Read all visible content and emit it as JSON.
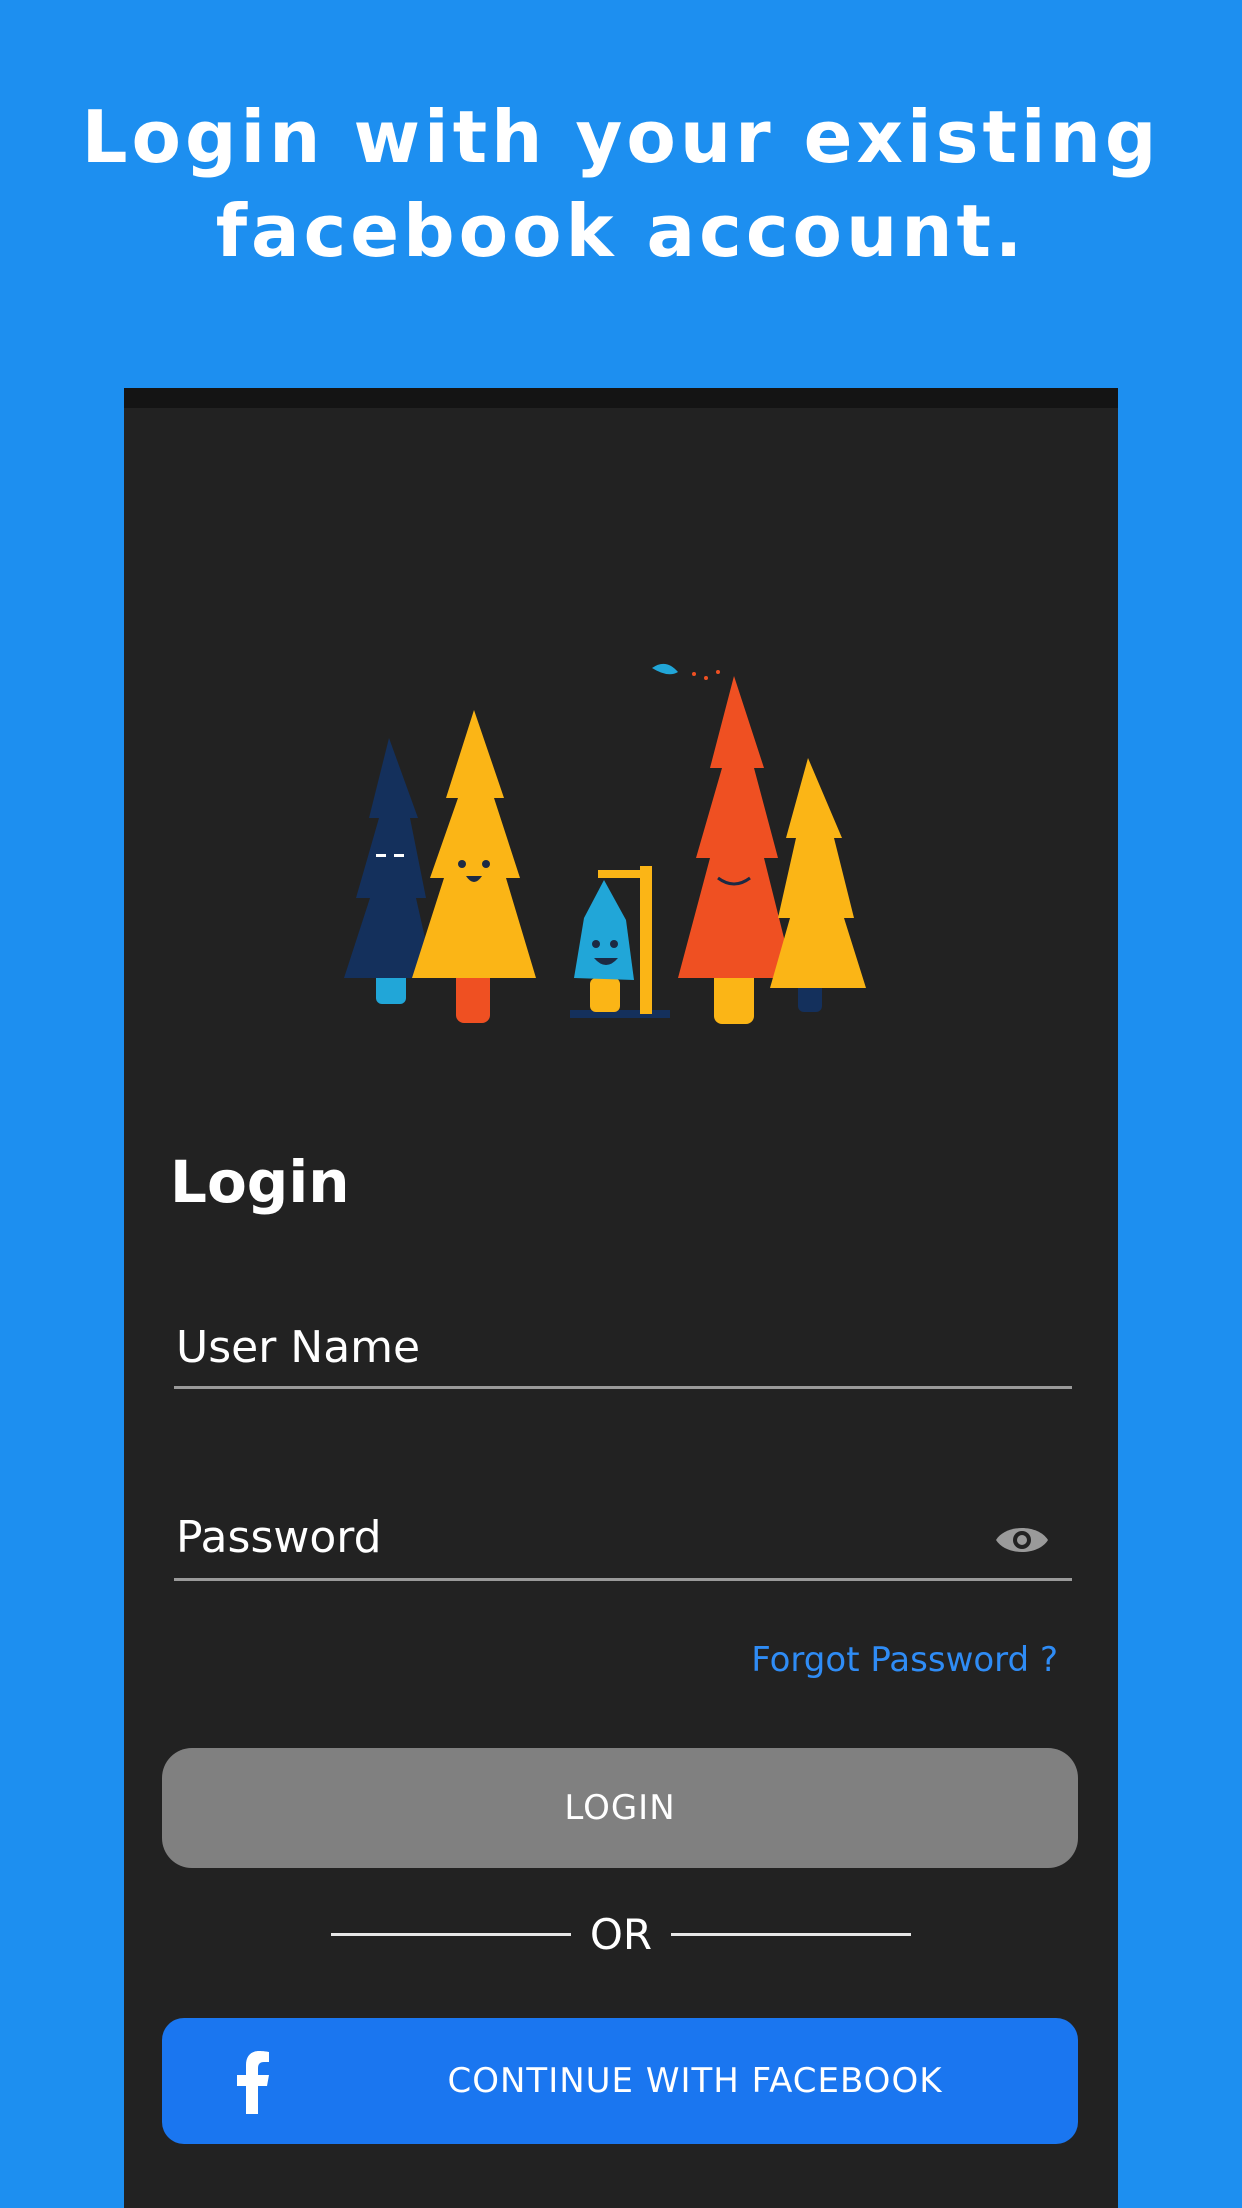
{
  "promo": {
    "headline_line1": "Login with your existing",
    "headline_line2": "facebook account."
  },
  "screen": {
    "title": "Login",
    "username": {
      "placeholder": "User Name"
    },
    "password": {
      "placeholder": "Password"
    },
    "forgot_password": "Forgot Password ?",
    "login_button": "LOGIN",
    "divider_text": "OR",
    "facebook_button": "CONTINUE WITH FACEBOOK"
  },
  "icons": {
    "password_toggle": "eye-icon",
    "facebook": "facebook-icon"
  },
  "colors": {
    "background": "#1d8ff0",
    "screen": "#222222",
    "login_button": "#808080",
    "facebook_button": "#1a76f0",
    "link": "#2f8cf5"
  }
}
